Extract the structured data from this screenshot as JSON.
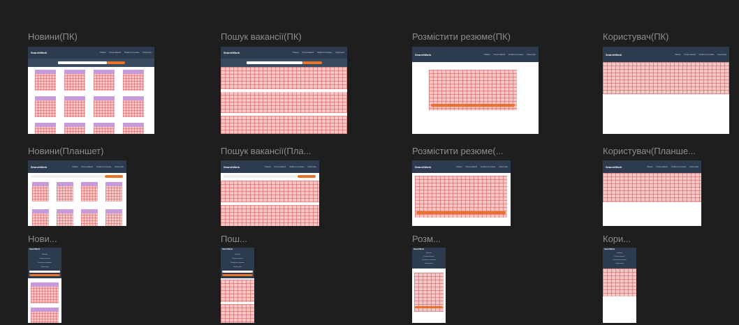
{
  "frames": {
    "news_pc": "Новини(ПК)",
    "search_pc": "Пошук вакансії(ПК)",
    "resume_pc": "Розмістити резюме(ПК)",
    "user_pc": "Користувач(ПК)",
    "news_tablet": "Новини(Планшет)",
    "search_tablet": "Пошук вакансії(Пла...",
    "resume_tablet": "Розмістити резюме(...",
    "user_tablet": "Користувач(Планше...",
    "news_mobile": "Нови...",
    "search_mobile": "Пош...",
    "resume_mobile": "Розм...",
    "user_mobile": "Кори..."
  },
  "app": {
    "logo": "SearchWork",
    "menu": [
      "Новини",
      "Пошук вакансії",
      "Розмістити резюме",
      "Користувач"
    ]
  },
  "colors": {
    "canvas": "#1e1e1e",
    "nav": "#2c3b4e",
    "grid_fill": "#f6c5c5",
    "card_header": "#c79bd9",
    "accent": "#e8732a"
  }
}
